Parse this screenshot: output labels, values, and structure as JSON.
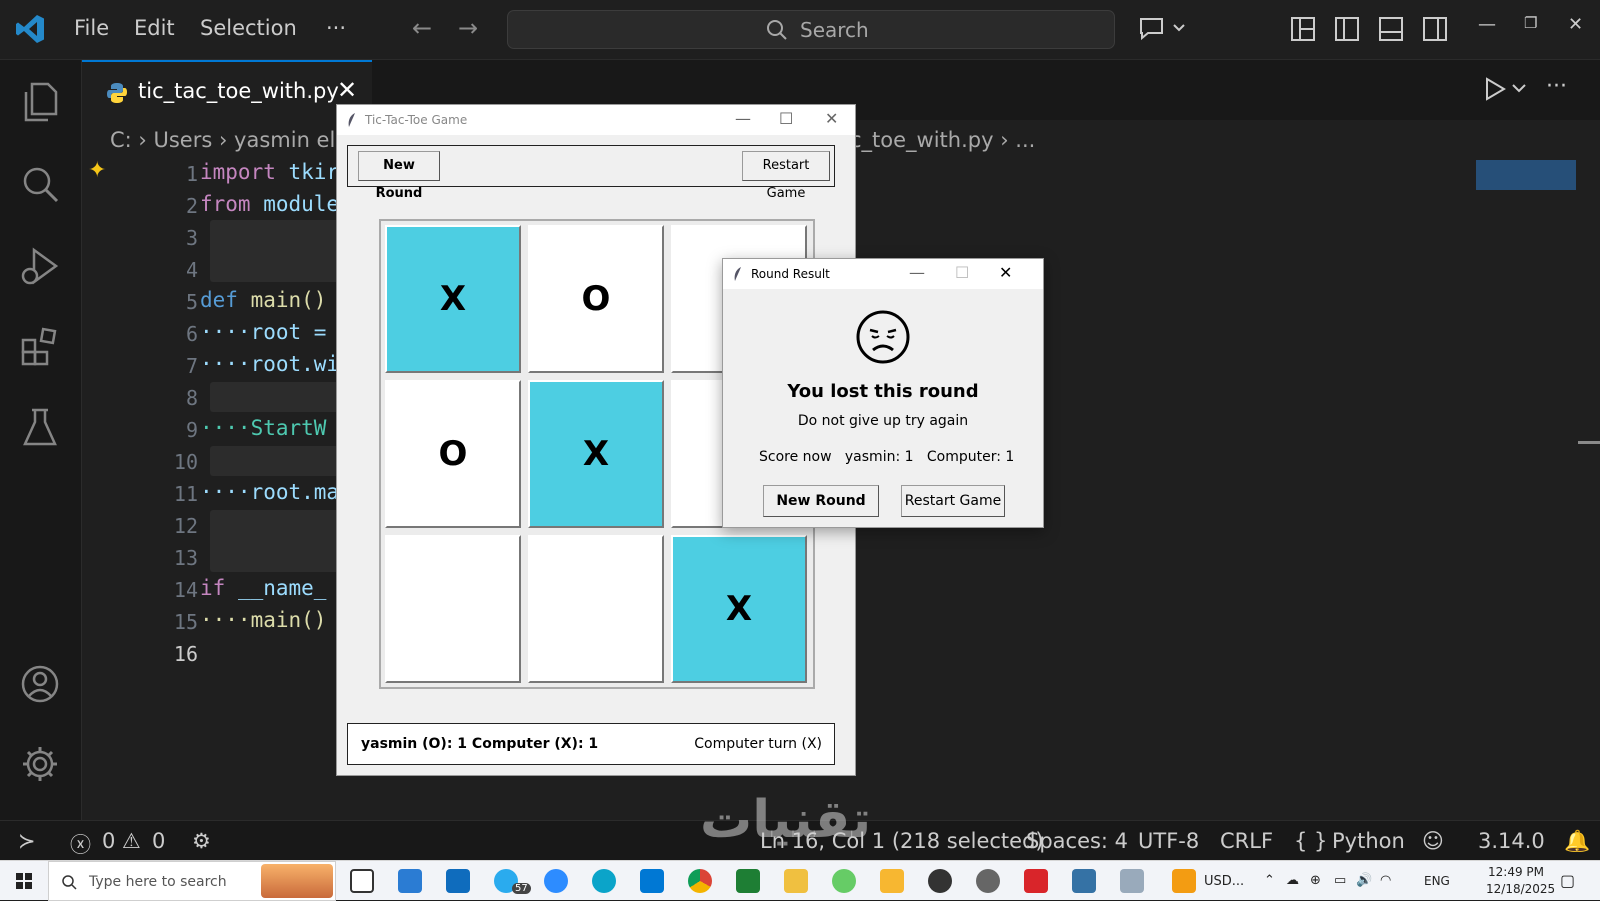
{
  "menu": {
    "file": "File",
    "edit": "Edit",
    "selection": "Selection",
    "more": "···"
  },
  "search": {
    "label": "Search"
  },
  "tab": {
    "label": "tic_tac_toe_with.py",
    "close": "✕"
  },
  "breadcrumb": {
    "left": "C: › Users › yasmin els",
    "right": "c_toe_with.py › ..."
  },
  "editor": {
    "line_numbers": [
      "1",
      "2",
      "3",
      "4",
      "5",
      "6",
      "7",
      "8",
      "9",
      "10",
      "11",
      "12",
      "13",
      "14",
      "15",
      "16"
    ],
    "code": {
      "l1a": "import",
      "l1b": " tkir",
      "l2a": "from",
      "l2b": " module",
      "l5a": "def",
      "l5b": " main()",
      "l6": "····root =",
      "l7": "····root.wi",
      "l9": "····StartW",
      "l11": "····root.ma",
      "l14a": "if",
      "l14b": " __name_",
      "l15": "····main()"
    }
  },
  "statusbar": {
    "errors": "0",
    "warnings": "0",
    "position": "Ln 16, Col 1 (218 selected)",
    "spaces": "Spaces: 4",
    "encoding": "UTF-8",
    "eol": "CRLF",
    "language": "Python",
    "version": "3.14.0"
  },
  "taskbar": {
    "search_placeholder": "Type here to search",
    "badge": "57",
    "weather": "USD...",
    "lang": "ENG",
    "time": "12:49 PM",
    "date": "12/18/2025"
  },
  "game": {
    "title": "Tic-Tac-Toe Game",
    "new_round": "New Round",
    "restart": "Restart Game",
    "board": [
      "X",
      "O",
      "",
      "O",
      "X",
      "",
      "",
      "",
      "X"
    ],
    "score_text": "yasmin (O): 1   Computer (X): 1",
    "turn_text": "Computer turn (X)"
  },
  "result": {
    "title": "Round Result",
    "heading": "You lost this round",
    "subtitle": "Do not give up try again",
    "score": "Score now   yasmin: 1   Computer: 1",
    "new_round": "New Round",
    "restart": "Restart Game"
  },
  "watermark": "تقنيات",
  "colors": {
    "accent": "#0078d4",
    "win_cell": "#4dcee2",
    "editor_bg": "#1f1f1f"
  }
}
